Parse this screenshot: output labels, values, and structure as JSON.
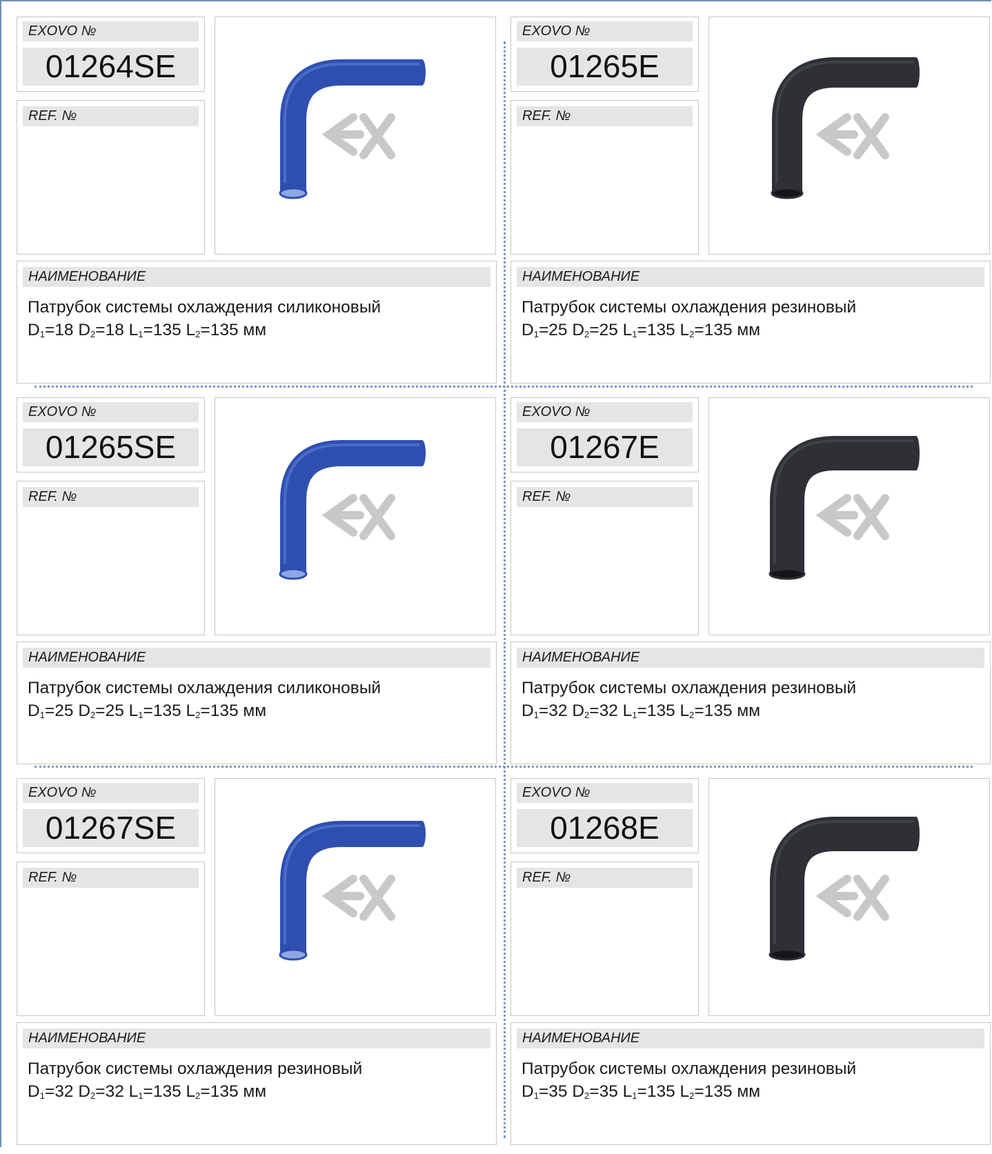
{
  "labels": {
    "exovo": "EXOVO №",
    "ref": "REF. №",
    "name": "НАИМЕНОВАНИЕ"
  },
  "units": {
    "mm": "мм"
  },
  "sub_digits": {
    "one": "1",
    "two": "2"
  },
  "colors": {
    "silicone_blue": "#2f4fb0",
    "rubber_black": "#2e3036",
    "watermark": "#c8c8c8",
    "divider": "#7a96c0"
  },
  "items": [
    {
      "code": "01264SE",
      "ref": "",
      "name_line1": "Патрубок системы охлаждения силиконовый",
      "d1": "18",
      "d2": "18",
      "l1": "135",
      "l2": "135",
      "material": "silicone",
      "image": "hose-elbow-blue-icon"
    },
    {
      "code": "01265E",
      "ref": "",
      "name_line1": "Патрубок системы охлаждения резиновый",
      "d1": "25",
      "d2": "25",
      "l1": "135",
      "l2": "135",
      "material": "rubber",
      "image": "hose-elbow-black-icon"
    },
    {
      "code": "01265SE",
      "ref": "",
      "name_line1": "Патрубок системы охлаждения силиконовый",
      "d1": "25",
      "d2": "25",
      "l1": "135",
      "l2": "135",
      "material": "silicone",
      "image": "hose-elbow-blue-icon"
    },
    {
      "code": "01267E",
      "ref": "",
      "name_line1": "Патрубок системы охлаждения резиновый",
      "d1": "32",
      "d2": "32",
      "l1": "135",
      "l2": "135",
      "material": "rubber",
      "image": "hose-elbow-black-icon"
    },
    {
      "code": "01267SE",
      "ref": "",
      "name_line1": "Патрубок системы охлаждения резиновый",
      "d1": "32",
      "d2": "32",
      "l1": "135",
      "l2": "135",
      "material": "silicone",
      "image": "hose-elbow-blue-icon"
    },
    {
      "code": "01268E",
      "ref": "",
      "name_line1": "Патрубок системы охлаждения резиновый",
      "d1": "35",
      "d2": "35",
      "l1": "135",
      "l2": "135",
      "material": "rubber",
      "image": "hose-elbow-black-icon"
    }
  ]
}
